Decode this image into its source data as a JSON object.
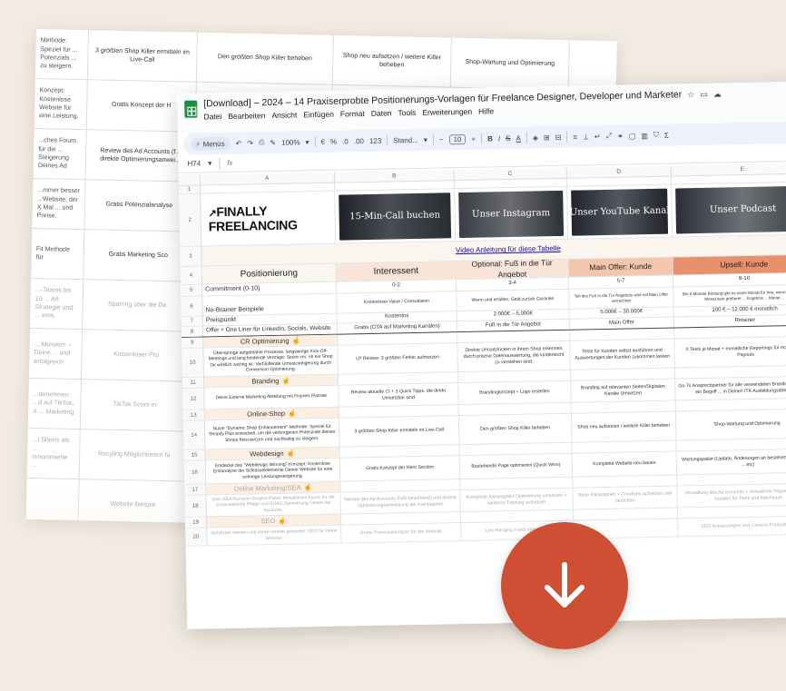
{
  "back_sheet": {
    "rows": [
      [
        "Methode: Speziel für ... Potenzials ... zu steigern.",
        "3 größten Shop Killer ermitteln im Live-Call",
        "Den größten Shop Killer beheben",
        "Shop neu aufsetzen / weitere Killer beheben",
        "Shop-Wartung und Optimierung"
      ],
      [
        "Konzept: Kostenlose Website für eine Leistung.",
        "Gratis Konzept der H",
        "",
        "",
        ""
      ],
      [
        "...ches Fixum für die ... Steigerung Deines Ad",
        "Review des Ad Accounts (f... direkte Optimierungsanwei...",
        "",
        "",
        ""
      ],
      [
        "...mmer besser ...Website, der X Mal ... und Preise.",
        "Gratis Potenzialanalyse",
        "",
        "",
        ""
      ],
      [
        "Fit Methode für",
        "Gratis Marketing Sco",
        "",
        "",
        ""
      ],
      [
        "...-Teams bis 10 ... Art Strategie und ... ems.",
        "Sparring über die De",
        "",
        "",
        ""
      ],
      [
        "... Monaten – Deine ... und erfolgreich",
        "Kostenloser Pro",
        "",
        "",
        ""
      ],
      [
        "...ternehmen ...d auf TikTok, X ... Marketing",
        "TikTok Score er",
        "",
        "",
        ""
      ],
      [
        "...t Shorts als ... renommierte ...",
        "Recyling Möglichkeiten fü",
        "",
        "",
        ""
      ],
      [
        "",
        "Website Beispie",
        "",
        "",
        ""
      ]
    ]
  },
  "window": {
    "doc_title": "[Download] – 2024 – 14 Praxiserprobte Positionerungs-Vorlagen für Freelance Designer, Developer und Marketer",
    "menu": [
      "Datei",
      "Bearbeiten",
      "Ansicht",
      "Einfügen",
      "Format",
      "Daten",
      "Tools",
      "Erweiterungen",
      "Hilfe"
    ]
  },
  "toolbar": {
    "search_label": "Menüs",
    "zoom": "100%",
    "currency": "€",
    "percent": "%",
    "dec_less": ".0",
    "dec_more": ".00",
    "num_format": "123",
    "font": "Stand...",
    "font_size": "10",
    "bold": "B",
    "italic": "I",
    "strike": "S",
    "text_color": "A"
  },
  "formula_bar": {
    "cell_ref": "H74",
    "fx": "fx",
    "value": ""
  },
  "columns": [
    "A",
    "B",
    "C",
    "D",
    "E"
  ],
  "row_numbers": [
    "1",
    "2",
    "3",
    "4",
    "5",
    "6",
    "7",
    "8",
    "9",
    "10",
    "11",
    "12",
    "13",
    "14",
    "15",
    "16",
    "17",
    "18",
    "19",
    "20"
  ],
  "branding": {
    "logo_line1": "FINALLY",
    "logo_line2": "FREELANCING",
    "thumb1": "15-Min-Call buchen",
    "thumb2": "Unser Instagram",
    "thumb3": "Unser YouTube Kanal",
    "thumb4": "Unser Podcast"
  },
  "link_row": {
    "video_link": "Video Anleitung für diese Tabelle"
  },
  "headers": {
    "a": "Positionierung",
    "b": "Interessent",
    "c": "Optional: Fuß in die Tür Angebot",
    "d": "Main Offer: Kunde",
    "e": "Upsell: Kunde"
  },
  "row5": {
    "a": "Commitment (0-10)",
    "b": "0-2",
    "c": "3-4",
    "d": "5-7",
    "e": "8-10"
  },
  "row6": {
    "a": "No-Brainer Beispiele",
    "b": "Kostenloser Value / Consultation",
    "c": "Wenn und erfüllen, Geld zurück Garantie",
    "d": "Teil des Fuß in die Tür Angebots wird mit Main Offer verrechnet",
    "e": "Bei 6 Monate Bindung gibt es einen Monat für free, wenn ... in einem Monat kein größerer ... Ergebnis ... Monat ..."
  },
  "row7": {
    "a": "Preispunkt",
    "b": "Kostenlos",
    "c": "2.000€ – 5.000€",
    "d": "5.000€ – 30.000€",
    "e": "100 € – 12.000 € monatlich"
  },
  "row8": {
    "a": "Offer + One Liner für LinkedIn, Socials, Website",
    "b": "Gratis (CTA auf Marketing Kanälen)",
    "c": "Fuß in die Tür Angebot",
    "d": "Main Offer",
    "e": "Retainer"
  },
  "sections": [
    {
      "title": "CR Optimierung",
      "desc": "Überspringe aufgeblähte Prozesse, langwierige Kick-Off-Meetings und lang bindende Verträge: Spüre vor, ob ein Shop Dir wirklich wichtig ist: Verblüffende Umsatzsteigerung durch Conversion Optimierung.",
      "b": "LP Review: 3 größten Fehler aufmerzen",
      "c": "Direkte Umsatzlücken in ihrem Shop erkennen durch präzise Datenauswertung, die kinderleicht zu verstehen sind.",
      "d": "Tests für Kunden selbst ausführen und Auswertungen der Kunden zukommen lassen",
      "e": "X Tests je Monat + monatliche Reportings für monatliches Payouts"
    },
    {
      "title": "Branding",
      "desc": "Deine Externe Marketing Abteilung mit Fixpreis Flatrate",
      "b": "Review aktuelle CI + 3 Quick Tipps, die direkt Umsetzbar sind",
      "c": "Brandingkonzept + Logo erstellen",
      "d": "Branding auf relevanten Seiten/Digitalen Kanäle Umsetzen",
      "e": "Go-To Ansprechpartner für alle verwendeten Brandings/Lieber für ein Begriff ... in Deinen ITK Ausbildungsabteilung"
    },
    {
      "title": "Online-Shop",
      "desc": "Nutze \"Dynamic Shop Enhancement\"-Methode: Speziel für Shopify Plus entwickelt, um die verborgenen Potenziale deines Shops freizusetzen und nachhaltig zu steigern.",
      "b": "3 größten Shop Killer ermitteln im Live-Call",
      "c": "Den größten Shop Killer beheben",
      "d": "Shop neu aufsetzen / weitere Killer beheben",
      "e": "Shop-Wartung und Optimierung"
    },
    {
      "title": "Webdesign",
      "desc": "Entdecke das \"Webdesign Winning\"-Konzept: Kostenlose Erstanalyse der Schlüsselelemente Deiner Website für eine sofortige Leistungssteigerung.",
      "b": "Gratis Konzept der Hero Section",
      "c": "Bestehende Page optimieren (Quick Wins)",
      "d": "Komplette Website neu bauen",
      "e": "Wartungspaket (Update, Änderungen an bestehendem Content ... etc)"
    },
    {
      "title": "Online Marketing/SEA",
      "desc": "Dein SEA-Rundum-Sorglos-Paket: Monatliches Fixum für die kontinuierliche Pflege und ROAS Optimierung Deines Ad Accounts.",
      "b": "Review des Ad Accounts (falls bestehend) und direkte Optimierungsanweisung der Kampagnen",
      "c": "Komplette Kampagnen Optimierung umsetzen + weiteres Tracking aufsetzen",
      "d": "Neue Kampagnen + Creatives aufsetzen und launchen",
      "e": "Verwaltung des Ad Accounts + monatliche Reportings an den Kunden für Tests und Wachstum"
    },
    {
      "title": "SEO",
      "desc": "Sichtbarer werden und immer besser gefunden: SEO für Deine Website.",
      "b": "Gratis Potenzialanalyse für die Website",
      "c": "Low-Hanging Fruits optimieren",
      "d": "",
      "e": "SEO Anpassungen und Content-Produktion ..."
    }
  ],
  "download_button": {
    "icon": "arrow-down-icon"
  }
}
